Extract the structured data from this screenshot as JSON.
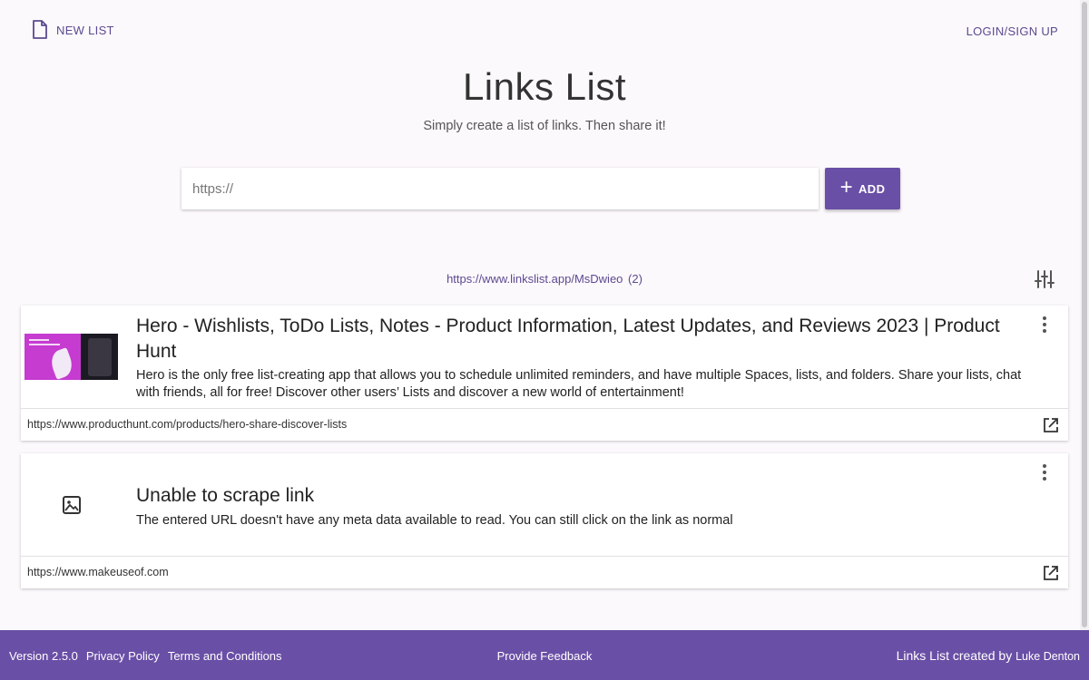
{
  "header": {
    "new_list_label": "NEW LIST",
    "login_label": "LOGIN/SIGN UP"
  },
  "hero": {
    "title": "Links List",
    "subtitle": "Simply create a list of links. Then share it!"
  },
  "add_form": {
    "url_value": "",
    "url_placeholder": "https://",
    "add_label": "ADD"
  },
  "share": {
    "url": "https://www.linkslist.app/MsDwieo",
    "count": "(2)"
  },
  "links": [
    {
      "title": "Hero - Wishlists, ToDo Lists, Notes - Product Information, Latest Updates, and Reviews 2023 | Product Hunt",
      "description": "Hero is the only free list-creating app that allows you to schedule unlimited reminders, and have multiple Spaces, lists, and folders. Share your lists, chat with friends, all for free! Discover other users’ Lists and discover a new world of entertainment!",
      "url": "https://www.producthunt.com/products/hero-share-discover-lists",
      "thumbnail": "image-thumbnail"
    },
    {
      "title": "Unable to scrape link",
      "description": "The entered URL doesn't have any meta data available to read. You can still click on the link as normal",
      "url": "https://www.makeuseof.com",
      "thumbnail": "image-placeholder-icon"
    }
  ],
  "footer": {
    "version": "Version 2.5.0",
    "privacy": "Privacy Policy",
    "terms": "Terms and Conditions",
    "feedback": "Provide Feedback",
    "credit_prefix": "Links List created by",
    "author": "Luke Denton"
  },
  "colors": {
    "accent": "#6a4fa6",
    "link": "#5c4a8f",
    "background": "#fcf9fd"
  }
}
